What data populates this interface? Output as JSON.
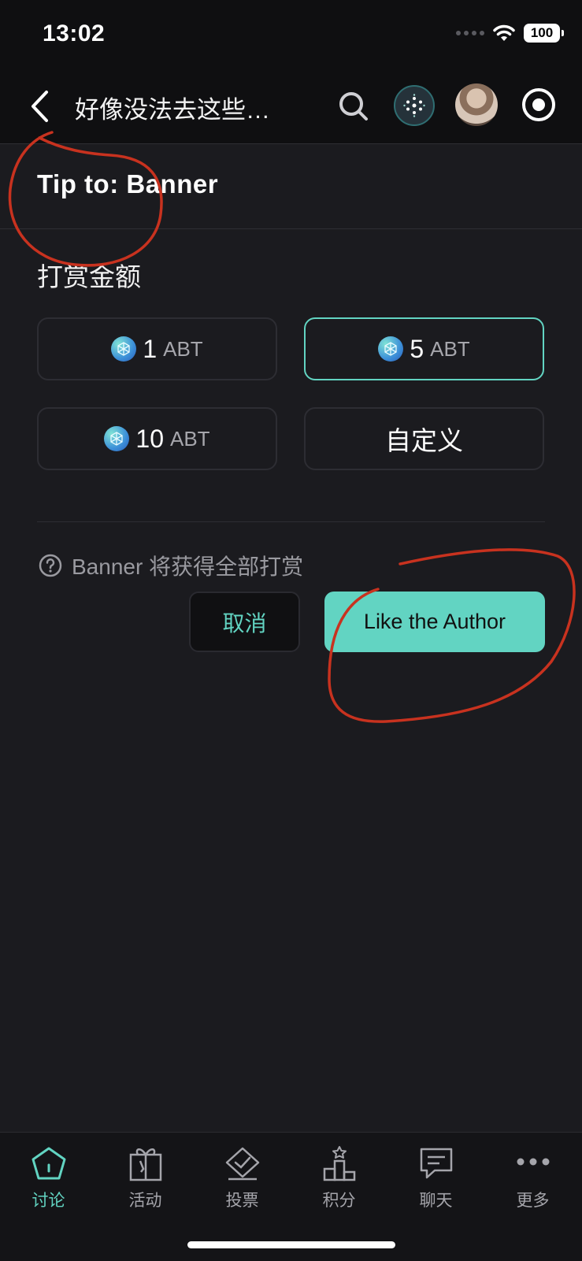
{
  "status_bar": {
    "time": "13:02",
    "battery": "100",
    "icons": [
      "signal-dots-icon",
      "wifi-icon",
      "battery-icon"
    ]
  },
  "nav": {
    "title": "好像没法去这些…",
    "icons": [
      "back-icon",
      "search-icon",
      "dao-icon",
      "avatar",
      "record-icon"
    ]
  },
  "tip": {
    "title": "Tip to: Banner",
    "section_label": "打赏金额",
    "options": [
      {
        "amount": "1",
        "unit": "ABT",
        "selected": false
      },
      {
        "amount": "5",
        "unit": "ABT",
        "selected": true
      },
      {
        "amount": "10",
        "unit": "ABT",
        "selected": false
      }
    ],
    "custom_label": "自定义",
    "notice": "Banner 将获得全部打赏",
    "cancel_label": "取消",
    "confirm_label": "Like the Author"
  },
  "tabs": [
    {
      "label": "讨论",
      "icon": "home-icon",
      "active": true
    },
    {
      "label": "活动",
      "icon": "gift-icon",
      "active": false
    },
    {
      "label": "投票",
      "icon": "vote-icon",
      "active": false
    },
    {
      "label": "积分",
      "icon": "podium-icon",
      "active": false
    },
    {
      "label": "聊天",
      "icon": "chat-icon",
      "active": false
    },
    {
      "label": "更多",
      "icon": "more-icon",
      "active": false
    }
  ],
  "colors": {
    "accent": "#62d4c2",
    "background": "#1b1b1f",
    "annotation": "#c8321f"
  }
}
